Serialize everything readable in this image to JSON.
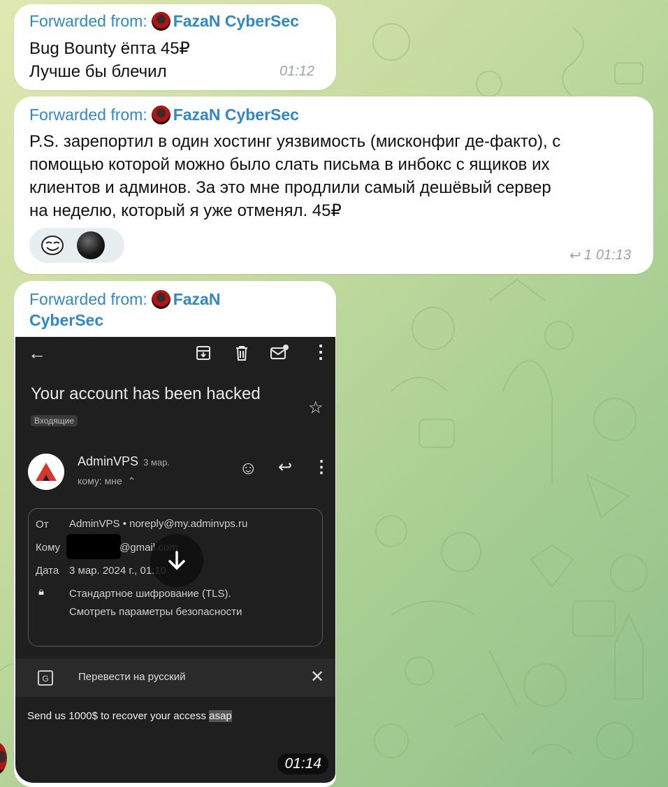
{
  "forward_label": "Forwarded from:",
  "source_name": "FazaN CyberSec",
  "source_name_line1": "FazaN",
  "source_name_line2": "CyberSec",
  "messages": [
    {
      "lines": [
        "Bug Bounty ёпта 45₽",
        "Лучше бы блечил"
      ],
      "time": "01:12"
    },
    {
      "lines": [
        "P.S. зарепортил в один хостинг уязвимость (мисконфиг де-факто), с",
        "помощью которой можно было слать письма в инбокс с ящиков их",
        "клиентов и админов. За это мне продлили самый дешёвый сервер",
        "на неделю, который я уже отменял. 45₽"
      ],
      "reply_count": "1",
      "time": "01:13"
    },
    {
      "time": "01:14"
    }
  ],
  "email": {
    "subject": "Your account has been hacked",
    "label": "Входящие",
    "sender": "AdminVPS",
    "date_short": "3 мар.",
    "to_short": "кому: мне",
    "details": {
      "from_label": "От",
      "from_value": "AdminVPS • noreply@my.adminvps.ru",
      "to_label": "Кому",
      "to_value": "@gmail.com",
      "date_label": "Дата",
      "date_value": "3 мар. 2024 г., 01:10",
      "encryption": "Стандартное шифрование (TLS).",
      "security_link": "Смотреть параметры безопасности"
    },
    "translate_text": "Перевести на русский",
    "body_main": "Send us 1000$ to recover your access ",
    "body_highlight": "asap"
  },
  "colors": {
    "link_blue": "#2f88c8",
    "bubble": "#ffffff",
    "email_bg": "#1f1f1f",
    "logo_red": "#d9362b"
  }
}
